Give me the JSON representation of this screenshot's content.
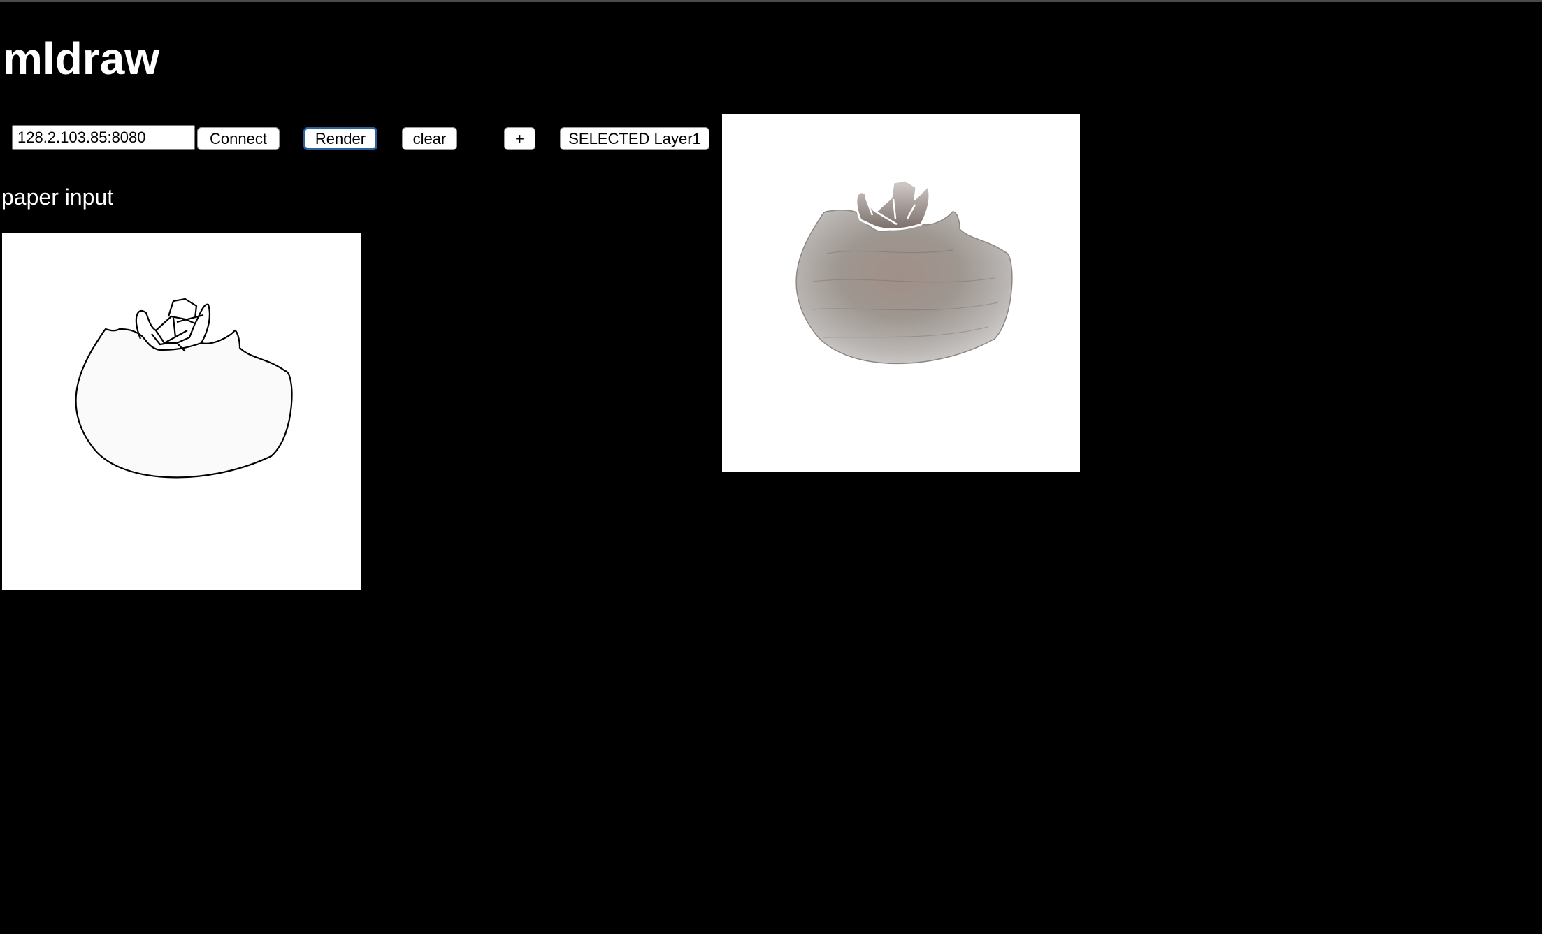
{
  "app": {
    "title": "mldraw"
  },
  "toolbar": {
    "server_address": "128.2.103.85:8080",
    "connect_label": "Connect",
    "render_label": "Render",
    "clear_label": "clear",
    "add_layer_label": "+",
    "layer_label": "SELECTED Layer1"
  },
  "paper": {
    "label": "paper input",
    "drawing_icon": "fruit-sketch-icon"
  },
  "output": {
    "image_icon": "rendered-fruit-image"
  },
  "colors": {
    "background": "#000000",
    "canvas": "#ffffff",
    "render_focus": "#2f5e9e"
  }
}
